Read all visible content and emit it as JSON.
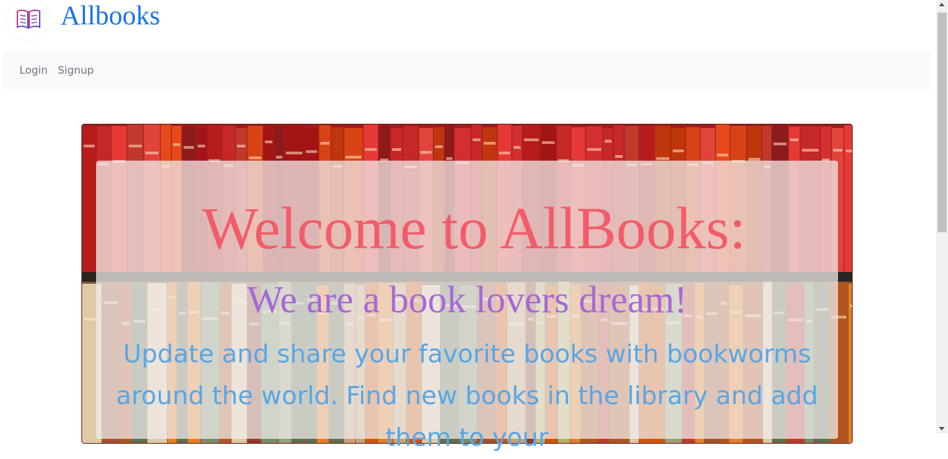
{
  "brand": {
    "name": "Allbooks",
    "logo_icon": "open-book-icon"
  },
  "nav": {
    "login_label": "Login",
    "signup_label": "Signup"
  },
  "hero": {
    "title": "Welcome to AllBooks:",
    "subtitle": "We are a book lovers dream!",
    "paragraph": "Update and share your favorite books with bookworms around the world. Find new books in the library and add them to your",
    "background": "bookshelf-photo",
    "colors": {
      "title": "#f25c6a",
      "subtitle": "#a768d8",
      "paragraph": "#58a6e6"
    }
  },
  "colors": {
    "brand": "#1a73e8",
    "navbar_bg": "#f8f9fa",
    "nav_text": "#6c757d"
  }
}
